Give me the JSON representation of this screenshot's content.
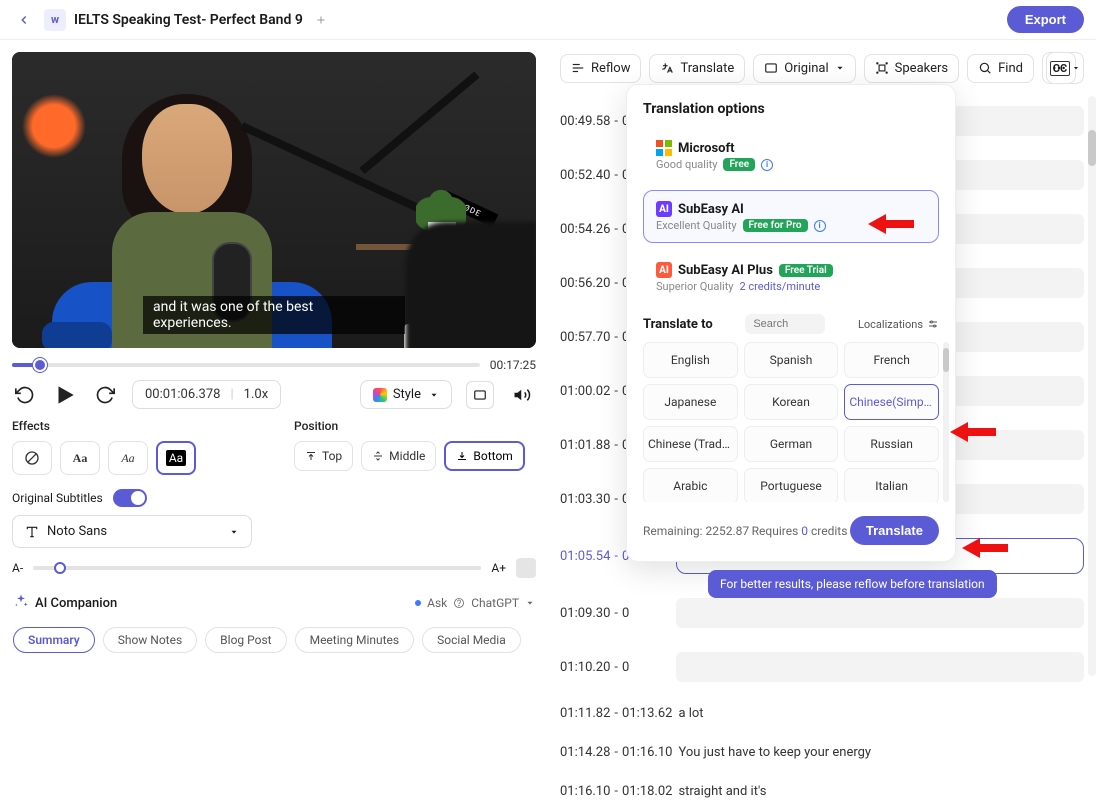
{
  "header": {
    "badge": "w",
    "title": "IELTS Speaking Test- Perfect Band 9",
    "export": "Export"
  },
  "video": {
    "caption": "and it was one of the best experiences.",
    "boom_brand": "RØDE",
    "duration": "00:17:25",
    "timecode": "00:01:06.378",
    "speed": "1.0x",
    "style_btn": "Style"
  },
  "effects": {
    "label": "Effects",
    "opts": [
      "Aa",
      "Aa",
      "Aa"
    ],
    "position_label": "Position",
    "positions": {
      "top": "Top",
      "middle": "Middle",
      "bottom": "Bottom"
    },
    "orig_sub_label": "Original Subtitles",
    "font": "Noto Sans",
    "size_minus": "A-",
    "size_plus": "A+"
  },
  "companion": {
    "title": "AI Companion",
    "ask": "Ask",
    "gpt": "ChatGPT",
    "tags": [
      "Summary",
      "Show Notes",
      "Blog Post",
      "Meeting Minutes",
      "Social Media"
    ]
  },
  "toolbar": {
    "reflow": "Reflow",
    "translate": "Translate",
    "original": "Original",
    "speakers": "Speakers",
    "find": "Find",
    "cc": "CC"
  },
  "transcript": [
    {
      "a": "00:49.58",
      "b": "0"
    },
    {
      "a": "00:52.40",
      "b": "0"
    },
    {
      "a": "00:54.26",
      "b": "0"
    },
    {
      "a": "00:56.20",
      "b": "0"
    },
    {
      "a": "00:57.70",
      "b": "0"
    },
    {
      "a": "01:00.02",
      "b": "0"
    },
    {
      "a": "01:01.88",
      "b": "0"
    },
    {
      "a": "01:03.30",
      "b": "0"
    },
    {
      "a": "01:05.54",
      "b": "0",
      "current": true,
      "insert": true
    },
    {
      "a": "01:09.30",
      "b": "0"
    },
    {
      "a": "01:10.20",
      "b": "0"
    },
    {
      "a": "01:11.82",
      "b": "01:13.62",
      "text": "a lot"
    },
    {
      "a": "01:14.28",
      "b": "01:16.10",
      "text": "You just have to keep your energy"
    },
    {
      "a": "01:16.10",
      "b": "01:18.02",
      "text": "straight and it's"
    }
  ],
  "popup": {
    "title": "Translation options",
    "providers": {
      "ms": {
        "name": "Microsoft",
        "sub": "Good quality",
        "badge": "Free"
      },
      "ai": {
        "name": "SubEasy AI",
        "sub": "Excellent Quality",
        "badge": "Free for Pro"
      },
      "aip": {
        "name": "SubEasy AI Plus",
        "sub": "Superior Quality",
        "badge": "Free Trial",
        "credits": "2 credits/minute"
      }
    },
    "translate_to": "Translate to",
    "search_ph": "Search",
    "localizations": "Localizations",
    "languages": [
      "English",
      "Spanish",
      "French",
      "Japanese",
      "Korean",
      "Chinese(Simpl...",
      "Chinese (Tradi...",
      "German",
      "Russian",
      "Arabic",
      "Portuguese",
      "Italian"
    ],
    "remaining_label": "Remaining:",
    "remaining_val": "2252.87",
    "requires_pre": "Requires",
    "requires_num": "0",
    "requires_post": "credits",
    "translate_btn": "Translate",
    "hint": "For better results, please reflow before translation"
  }
}
